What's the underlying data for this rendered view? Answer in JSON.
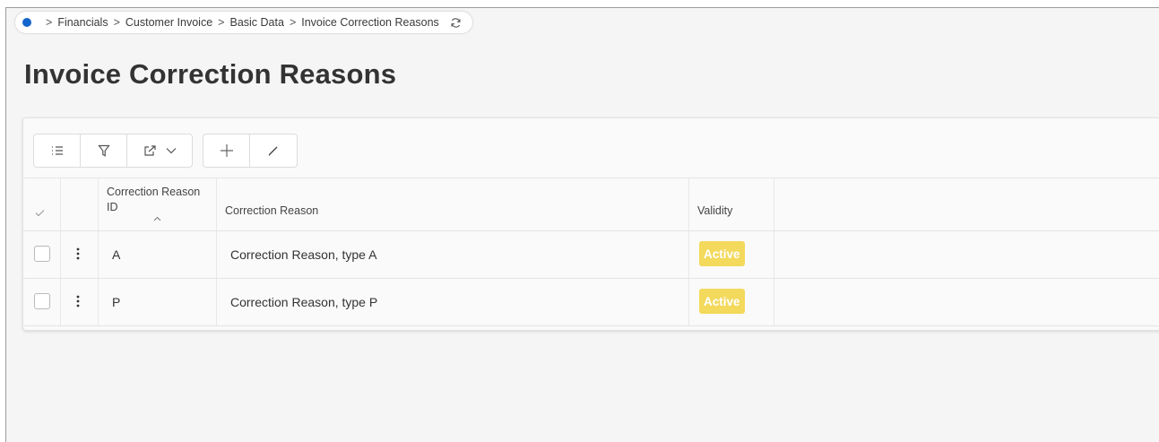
{
  "breadcrumb": {
    "items": [
      "Financials",
      "Customer Invoice",
      "Basic Data",
      "Invoice Correction Reasons"
    ],
    "icons": {
      "home": "home-dot-icon",
      "refresh": "refresh-icon"
    }
  },
  "page": {
    "title": "Invoice Correction Reasons"
  },
  "toolbar": {
    "buttons": [
      "list-icon",
      "filter-icon",
      "export-icon",
      "chevron-down-icon",
      "plus-icon",
      "pencil-icon"
    ]
  },
  "table": {
    "headers": {
      "id": "Correction Reason ID",
      "reason": "Correction Reason",
      "validity": "Validity"
    },
    "rows": [
      {
        "id": "A",
        "reason": "Correction Reason, type A",
        "validity": "Active"
      },
      {
        "id": "P",
        "reason": "Correction Reason, type P",
        "validity": "Active"
      }
    ]
  },
  "colors": {
    "accent": "#1466cc",
    "badge": "#f3d95c"
  }
}
